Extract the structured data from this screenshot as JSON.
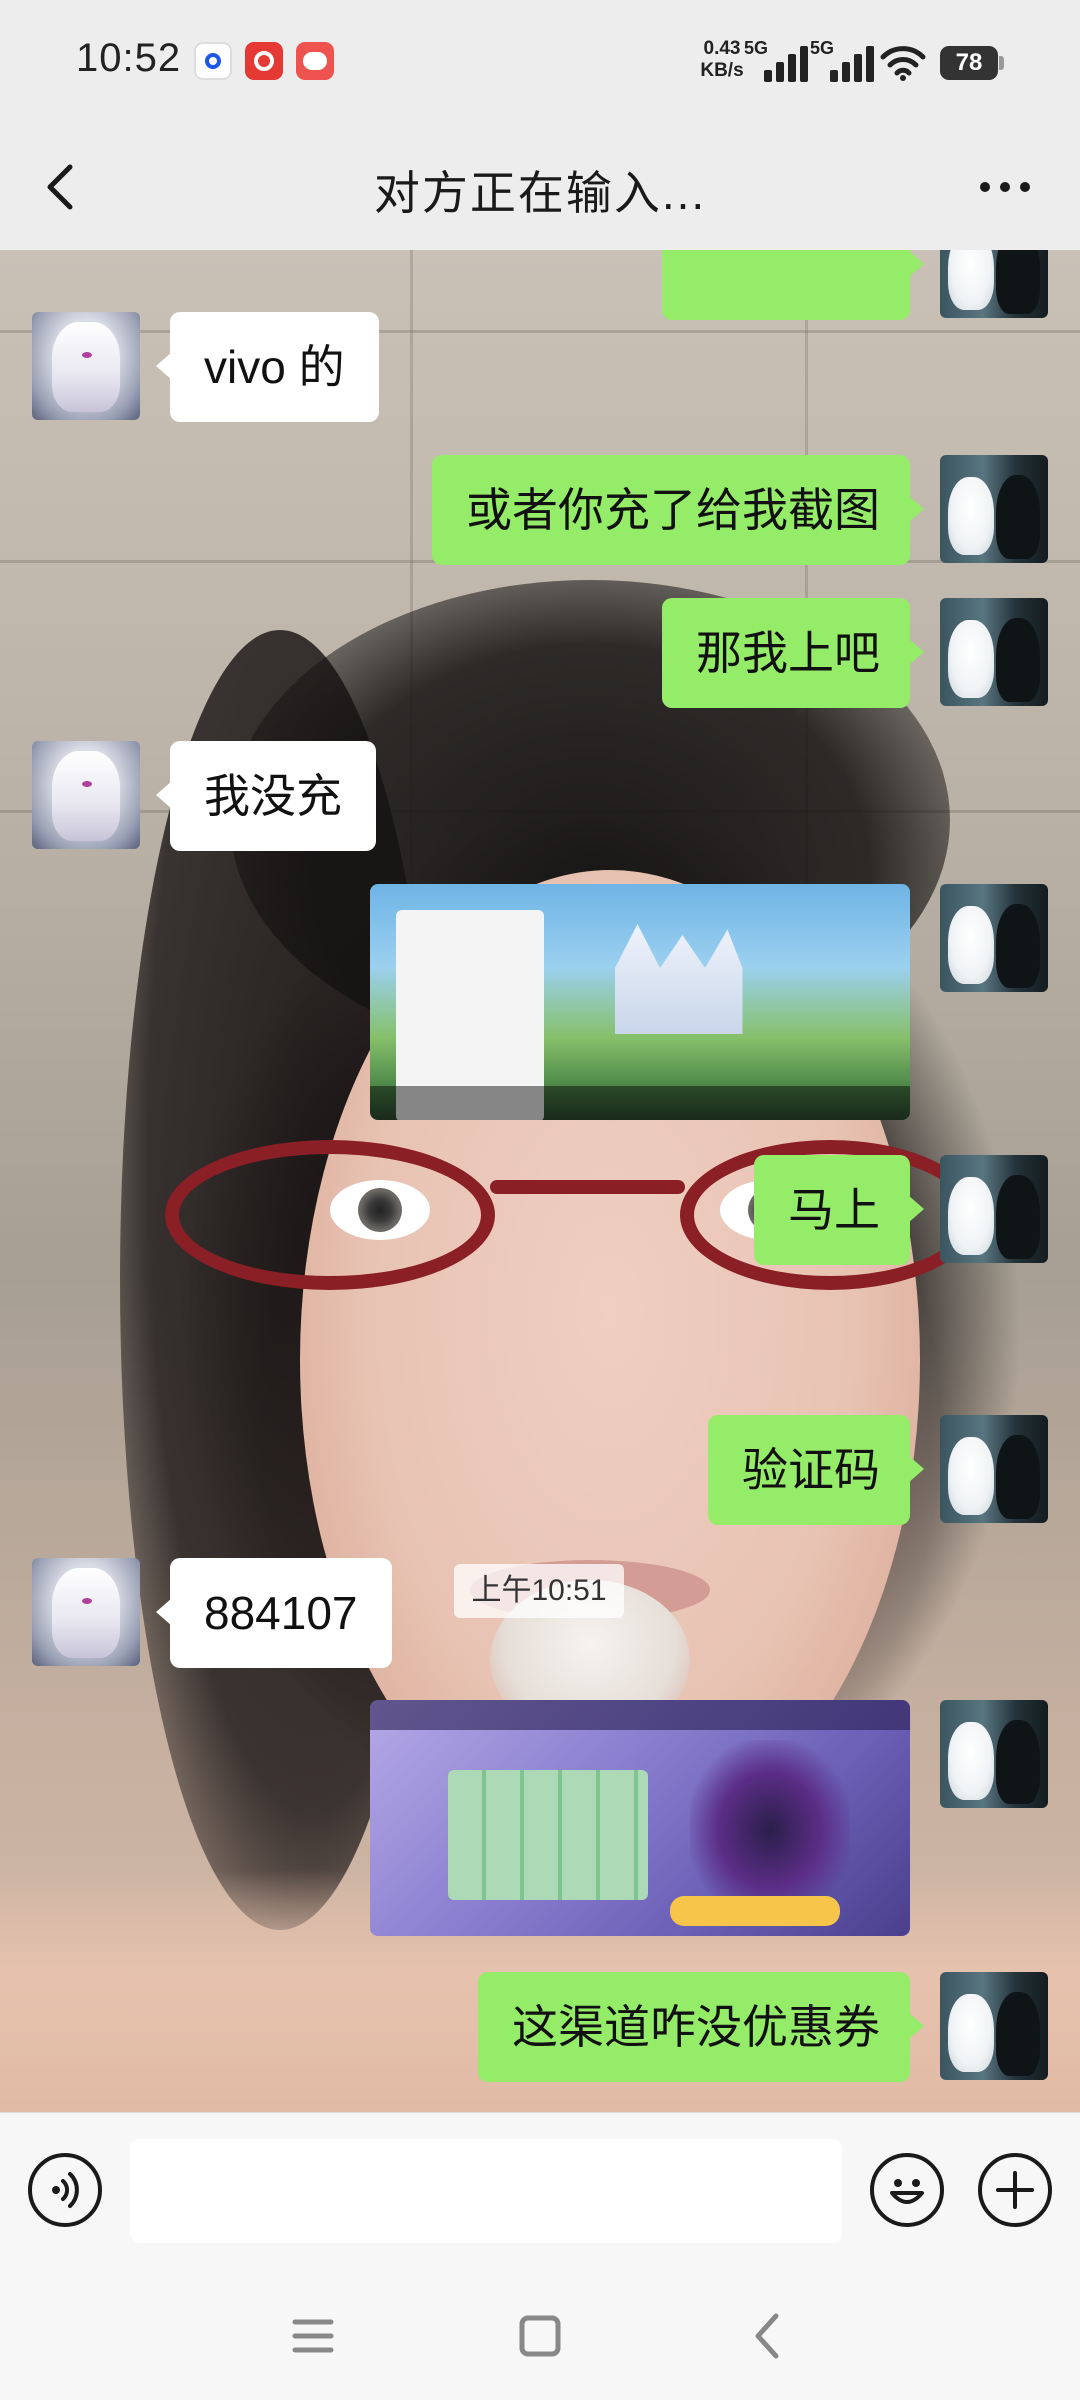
{
  "status_bar": {
    "time": "10:52",
    "net_speed_value": "0.43",
    "net_speed_unit": "KB/s",
    "sim1_label": "5G",
    "sim2_label": "5G",
    "battery": "78",
    "notification_icons": [
      "browser-icon",
      "netease-music-icon",
      "game-app-icon"
    ]
  },
  "header": {
    "title": "对方正在输入..."
  },
  "messages": [
    {
      "side": "self",
      "type": "text",
      "text": ""
    },
    {
      "side": "peer",
      "type": "text",
      "text": "vivo 的"
    },
    {
      "side": "self",
      "type": "text",
      "text": "或者你充了给我截图"
    },
    {
      "side": "self",
      "type": "text",
      "text": "那我上吧"
    },
    {
      "side": "peer",
      "type": "text",
      "text": "我没充"
    },
    {
      "side": "self",
      "type": "image",
      "image": "castle-game-screenshot"
    },
    {
      "side": "self",
      "type": "text",
      "text": "马上"
    },
    {
      "side": "divider",
      "type": "time",
      "text": "上午10:51"
    },
    {
      "side": "self",
      "type": "text",
      "text": "验证码"
    },
    {
      "side": "peer",
      "type": "text",
      "text": "884107"
    },
    {
      "side": "self",
      "type": "image",
      "image": "game-lineup-screenshot"
    },
    {
      "side": "self",
      "type": "text",
      "text": "这渠道咋没优惠券"
    }
  ],
  "input_bar": {
    "value": "",
    "voice_icon": "voice-icon",
    "emoji_icon": "emoji-icon",
    "plus_icon": "plus-icon"
  },
  "colors": {
    "self_bubble": "#95ec69",
    "peer_bubble": "#ffffff",
    "bar_background": "#ededed"
  }
}
